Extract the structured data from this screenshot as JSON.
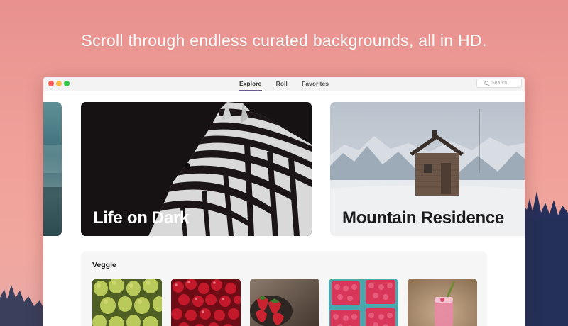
{
  "headline": "Scroll through endless curated backgrounds, all in HD.",
  "window": {
    "tabs": [
      {
        "label": "Explore",
        "active": true
      },
      {
        "label": "Roll",
        "active": false
      },
      {
        "label": "Favorites",
        "active": false
      }
    ],
    "search_placeholder": "Search"
  },
  "hero_cards": [
    {
      "title": "Life on Dark",
      "theme": "dark"
    },
    {
      "title": "Mountain Residence",
      "theme": "light"
    }
  ],
  "section": {
    "title": "Veggie",
    "thumbnails": [
      {
        "subject": "pears"
      },
      {
        "subject": "cherries"
      },
      {
        "subject": "strawberries"
      },
      {
        "subject": "raspberries"
      },
      {
        "subject": "smoothie"
      }
    ]
  },
  "colors": {
    "accent_underline": "#6b5a86",
    "traffic_close": "#fc605c",
    "traffic_min": "#fdbc40",
    "traffic_max": "#34c84a"
  }
}
